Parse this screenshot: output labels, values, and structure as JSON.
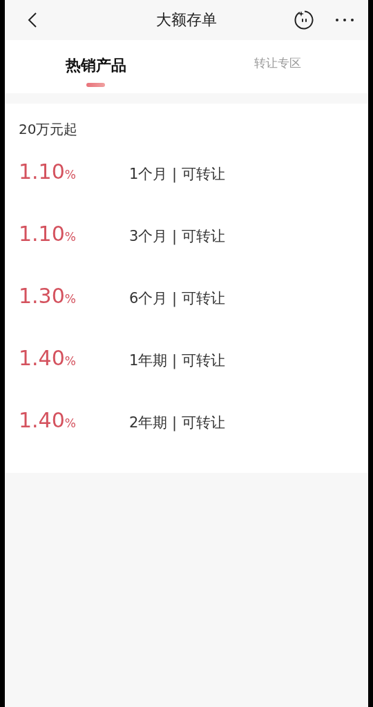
{
  "header": {
    "title": "大额存单"
  },
  "tabs": [
    {
      "label": "热销产品",
      "selected": true
    },
    {
      "label": "转让专区",
      "selected": false
    }
  ],
  "section": {
    "title": "20万元起"
  },
  "products": [
    {
      "rate": "1.10",
      "unit": "%",
      "term": "1个月 | 可转让"
    },
    {
      "rate": "1.10",
      "unit": "%",
      "term": "3个月 | 可转让"
    },
    {
      "rate": "1.30",
      "unit": "%",
      "term": "6个月 | 可转让"
    },
    {
      "rate": "1.40",
      "unit": "%",
      "term": "1年期 | 可转让"
    },
    {
      "rate": "1.40",
      "unit": "%",
      "term": "2年期 | 可转让"
    }
  ]
}
